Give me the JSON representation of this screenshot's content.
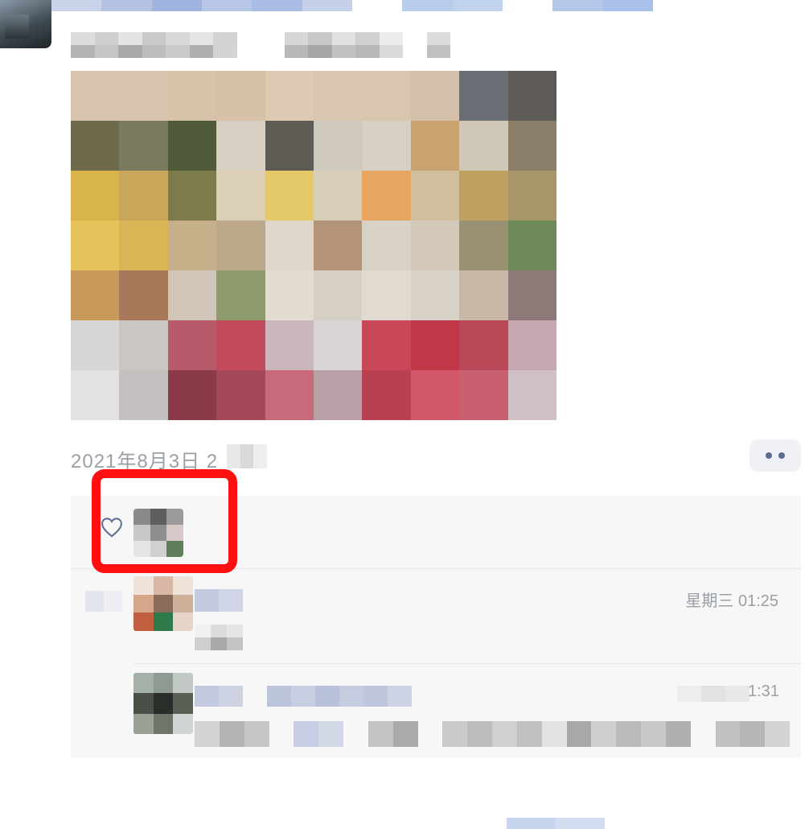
{
  "post": {
    "date_prefix": "2021年8月3日 2",
    "more_icon": "more-dots-icon"
  },
  "likes": {
    "icon": "heart-outline-icon"
  },
  "comments": [
    {
      "time": "星期三 01:25"
    },
    {
      "time_suffix": "1:31"
    }
  ],
  "colors": {
    "highlight": "#ff1010",
    "link_blue": "#5b6b94",
    "panel_bg": "#f7f7f7",
    "meta_text": "#9aa0a6"
  }
}
